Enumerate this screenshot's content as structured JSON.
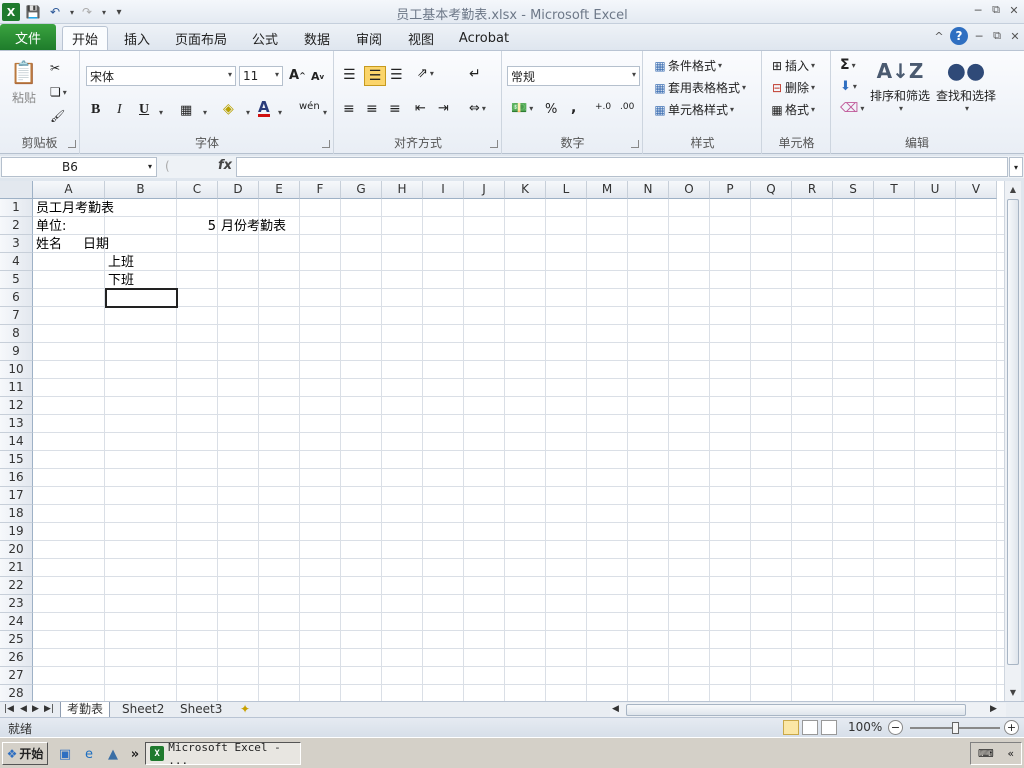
{
  "window": {
    "title": "员工基本考勤表.xlsx  -  Microsoft Excel"
  },
  "ribbon_tabs": {
    "file": "文件",
    "tabs": [
      "开始",
      "插入",
      "页面布局",
      "公式",
      "数据",
      "审阅",
      "视图",
      "Acrobat"
    ],
    "active_index": 0
  },
  "ribbon": {
    "clipboard": {
      "paste": "粘贴",
      "label": "剪贴板"
    },
    "font": {
      "name": "宋体",
      "size": "11",
      "bold": "B",
      "italic": "I",
      "underline": "U",
      "label": "字体",
      "phonetic": "wén"
    },
    "alignment": {
      "label": "对齐方式"
    },
    "number": {
      "format": "常规",
      "percent": "%",
      "comma": ",",
      "label": "数字"
    },
    "styles": {
      "conditional": "条件格式",
      "table": "套用表格格式",
      "cell_styles": "单元格样式",
      "label": "样式"
    },
    "cells": {
      "insert": "插入",
      "delete": "删除",
      "format": "格式",
      "label": "单元格"
    },
    "editing": {
      "sort_filter": "排序和筛选",
      "find_select": "查找和选择",
      "label": "编辑",
      "sigma": "Σ"
    }
  },
  "formula_bar": {
    "name_box": "B6",
    "fx": "fx",
    "formula": ""
  },
  "sheet": {
    "columns": [
      "A",
      "B",
      "C",
      "D",
      "E",
      "F",
      "G",
      "H",
      "I",
      "J",
      "K",
      "L",
      "M",
      "N",
      "O",
      "P",
      "Q",
      "R",
      "S",
      "T",
      "U",
      "V"
    ],
    "rows": [
      "1",
      "2",
      "3",
      "4",
      "5",
      "6",
      "7",
      "8",
      "9",
      "10",
      "11",
      "12",
      "13",
      "14",
      "15",
      "16",
      "17",
      "18",
      "19",
      "20",
      "21",
      "22",
      "23",
      "24",
      "25",
      "26",
      "27",
      "28"
    ],
    "cells": {
      "A1": "员工月考勤表",
      "A2": "单位:",
      "C2": "5",
      "D2": "月份考勤表",
      "A3": "姓名",
      "A3b": "日期",
      "B4": "上班",
      "B5": "下班"
    }
  },
  "sheet_tabs": [
    "考勤表",
    "Sheet2",
    "Sheet3"
  ],
  "status": {
    "text": "就绪",
    "zoom": "100%"
  },
  "taskbar": {
    "start": "开始",
    "task": "Microsoft Excel - ...",
    "chevron": "»"
  }
}
